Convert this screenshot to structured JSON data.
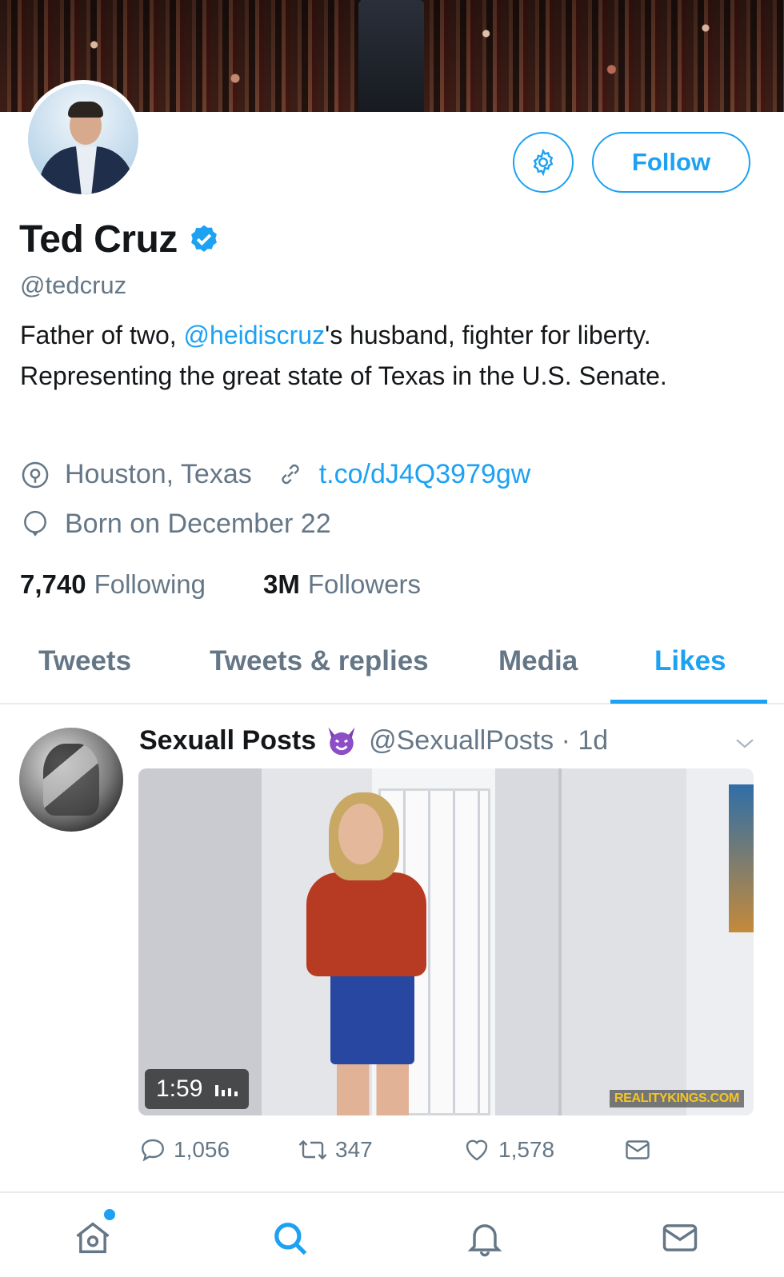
{
  "profile": {
    "name": "Ted Cruz",
    "handle": "@tedcruz",
    "bio_part1": "Father of two, ",
    "bio_mention": "@heidiscruz",
    "bio_part2": "'s husband, fighter for liberty. Representing the great state of Texas in the U.S. Senate.",
    "location": "Houston, Texas",
    "website": "t.co/dJ4Q3979gw",
    "birthday": "Born on December 22",
    "following_count": "7,740",
    "following_label": "Following",
    "followers_count": "3M",
    "followers_label": "Followers"
  },
  "buttons": {
    "follow_label": "Follow",
    "settings_icon": "gear-icon"
  },
  "tabs": [
    {
      "label": "Tweets",
      "active": false
    },
    {
      "label": "Tweets & replies",
      "active": false
    },
    {
      "label": "Media",
      "active": false
    },
    {
      "label": "Likes",
      "active": true
    }
  ],
  "tweet": {
    "author_name": "Sexuall Posts",
    "author_emoji": "smiling-devil-icon",
    "author_handle_time": "@SexuallPosts · 1d",
    "video_duration": "1:59",
    "watermark": "REALITYKINGS.COM",
    "replies": "1,056",
    "retweets": "347",
    "likes": "1,578"
  },
  "colors": {
    "accent": "#1da1f2",
    "muted": "#657786",
    "text": "#14171a"
  },
  "nav": [
    "home-icon",
    "search-icon",
    "bell-icon",
    "mail-icon"
  ]
}
